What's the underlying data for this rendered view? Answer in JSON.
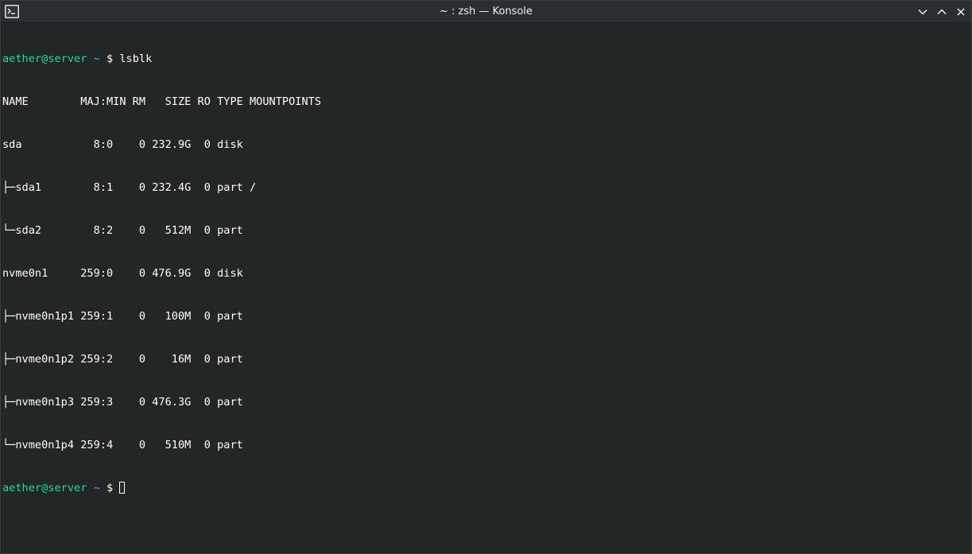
{
  "window": {
    "title": "~ : zsh — Konsole"
  },
  "icons": {
    "app": "terminal-icon",
    "minimize": "chevron-down-icon",
    "maximize": "chevron-up-icon",
    "close": "close-icon"
  },
  "colors": {
    "background": "#232627",
    "titlebar": "#2a2e32",
    "text": "#fcfcfc",
    "user_host": "#1cdc9a",
    "path": "#3daee9"
  },
  "prompt": {
    "user_host": "aether@server",
    "path": "~",
    "symbol": "$"
  },
  "command": "lsblk",
  "output": {
    "header": "NAME        MAJ:MIN RM   SIZE RO TYPE MOUNTPOINTS",
    "rows": [
      "sda           8:0    0 232.9G  0 disk ",
      "├─sda1        8:1    0 232.4G  0 part /",
      "└─sda2        8:2    0   512M  0 part ",
      "nvme0n1     259:0    0 476.9G  0 disk ",
      "├─nvme0n1p1 259:1    0   100M  0 part ",
      "├─nvme0n1p2 259:2    0    16M  0 part ",
      "├─nvme0n1p3 259:3    0 476.3G  0 part ",
      "└─nvme0n1p4 259:4    0   510M  0 part "
    ]
  }
}
